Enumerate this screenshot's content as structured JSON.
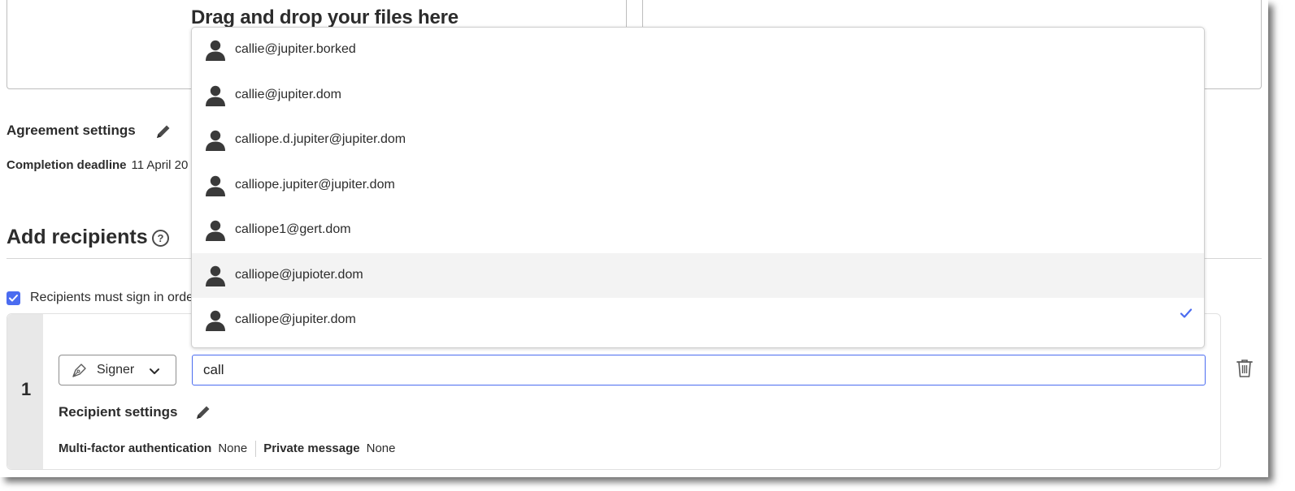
{
  "upload": {
    "drop_title": "Drag and drop your files here"
  },
  "agreement": {
    "title": "Agreement settings",
    "deadline_label": "Completion deadline",
    "deadline_value": "11 April 20"
  },
  "recipients": {
    "title": "Add recipients",
    "help_glyph": "?",
    "sign_order_label": "Recipients must sign in order",
    "sign_order_checked": true,
    "card": {
      "index": "1",
      "role": "Signer",
      "email_value": "call",
      "settings_title": "Recipient settings",
      "mfa_label": "Multi-factor authentication",
      "mfa_value": "None",
      "private_label": "Private message",
      "private_value": "None"
    }
  },
  "suggestions": [
    {
      "email": "callie@jupiter.borked",
      "highlighted": false,
      "selected": false
    },
    {
      "email": "callie@jupiter.dom",
      "highlighted": false,
      "selected": false
    },
    {
      "email": "calliope.d.jupiter@jupiter.dom",
      "highlighted": false,
      "selected": false
    },
    {
      "email": "calliope.jupiter@jupiter.dom",
      "highlighted": false,
      "selected": false
    },
    {
      "email": "calliope1@gert.dom",
      "highlighted": false,
      "selected": false
    },
    {
      "email": "calliope@jupioter.dom",
      "highlighted": true,
      "selected": false
    },
    {
      "email": "calliope@jupiter.dom",
      "highlighted": false,
      "selected": true
    }
  ],
  "icons": {
    "edit": "pencil-icon",
    "help": "help-circle-icon",
    "role": "pen-nib-icon",
    "chevron": "chevron-down-icon",
    "trash": "trash-icon",
    "avatar": "person-icon",
    "check": "checkmark-icon"
  },
  "colors": {
    "accent": "#4b6cf0",
    "highlight_row": "#f3f3f3",
    "index_bg": "#e8e8e8"
  }
}
